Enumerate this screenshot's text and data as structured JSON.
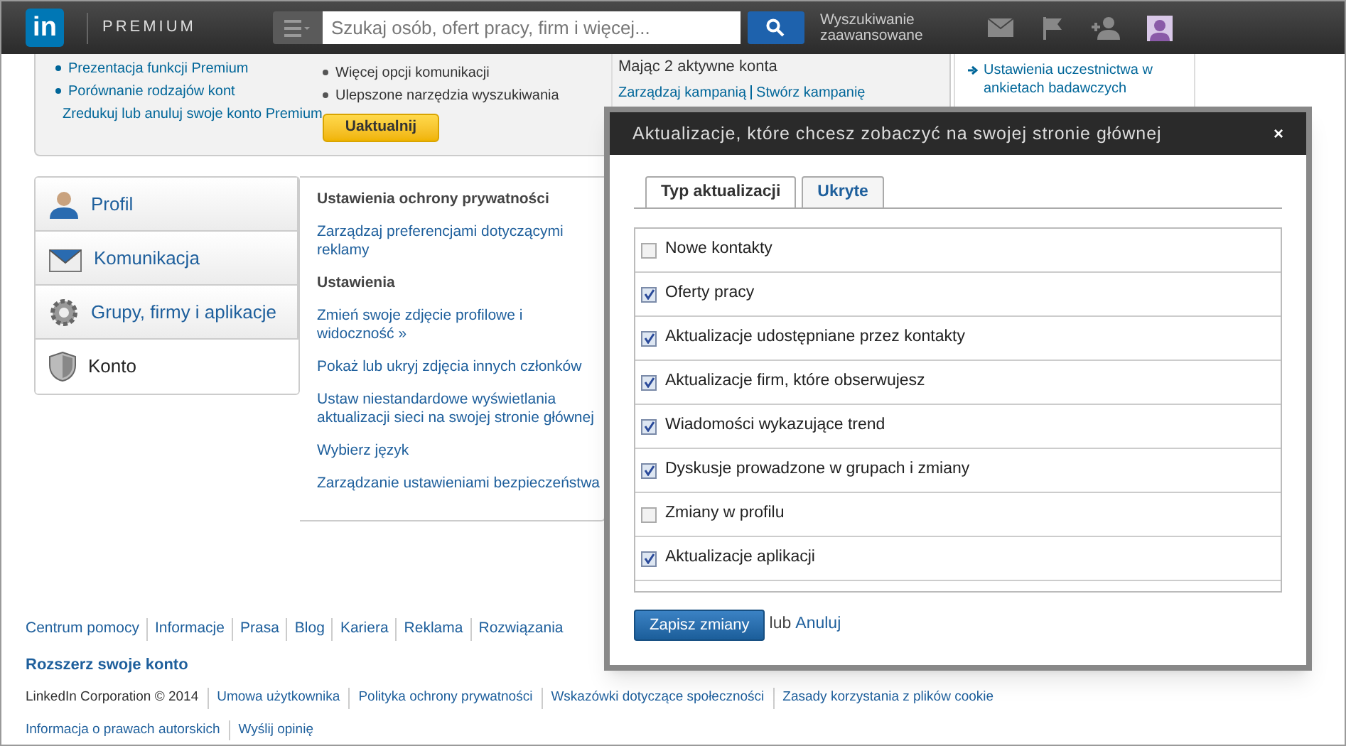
{
  "header": {
    "brand": "in",
    "premium": "PREMIUM",
    "search": {
      "placeholder": "Szukaj osób, ofert pracy, firm i więcej..."
    },
    "advanced": "Wyszukiwanie zaawansowane"
  },
  "premium_box": {
    "col1": [
      "Prezentacja funkcji Premium",
      "Porównanie rodzajów kont",
      "Zredukuj lub anuluj swoje konto Premium"
    ],
    "col2": [
      "Więcej opcji komunikacji",
      "Ulepszone narzędzia wyszukiwania"
    ],
    "upgrade": "Uaktualnij",
    "col3_heading": "Mając 2 aktywne konta",
    "col3_links": [
      "Zarządzaj kampanią",
      "Stwórz kampanię"
    ]
  },
  "side_box": {
    "link": "Ustawienia uczestnictwa w ankietach badawczych"
  },
  "sidebar": {
    "items": [
      {
        "label": "Profil",
        "kind": "profile",
        "selected": false
      },
      {
        "label": "Komunikacja",
        "kind": "mail",
        "selected": false
      },
      {
        "label": "Grupy, firmy i aplikacje",
        "kind": "gear",
        "selected": false
      },
      {
        "label": "Konto",
        "kind": "shield",
        "selected": true
      }
    ]
  },
  "settings": [
    {
      "kind": "heading",
      "text": "Ustawienia ochrony prywatności"
    },
    {
      "kind": "link",
      "text": "Zarządzaj preferencjami dotyczącymi reklamy"
    },
    {
      "kind": "heading",
      "text": "Ustawienia"
    },
    {
      "kind": "link",
      "text": "Zmień swoje zdjęcie profilowe i widoczność »"
    },
    {
      "kind": "link",
      "text": "Pokaż lub ukryj zdjęcia innych członków"
    },
    {
      "kind": "link",
      "text": "Ustaw niestandardowe wyświetlania aktualizacji sieci na swojej stronie głównej"
    },
    {
      "kind": "link",
      "text": "Wybierz język"
    },
    {
      "kind": "link",
      "text": "Zarządzanie ustawieniami bezpieczeństwa"
    }
  ],
  "footer": {
    "links": [
      "Centrum pomocy",
      "Informacje",
      "Prasa",
      "Blog",
      "Kariera",
      "Reklama",
      "Rozwiązania"
    ],
    "upgrade": "Rozszerz swoje konto",
    "copyright": "LinkedIn Corporation © 2014",
    "legal": [
      "Umowa użytkownika",
      "Polityka ochrony prywatności",
      "Wskazówki dotyczące społeczności",
      "Zasady korzystania z plików cookie",
      "Informacja o prawach autorskich",
      "Wyślij opinię"
    ]
  },
  "dialog": {
    "title": "Aktualizacje, które chcesz zobaczyć na swojej stronie głównej",
    "close": "×",
    "tabs": [
      {
        "label": "Typ aktualizacji",
        "selected": true
      },
      {
        "label": "Ukryte",
        "selected": false
      }
    ],
    "options": [
      {
        "label": "Nowe kontakty",
        "checked": false
      },
      {
        "label": "Oferty pracy",
        "checked": true
      },
      {
        "label": "Aktualizacje udostępniane przez kontakty",
        "checked": true
      },
      {
        "label": "Aktualizacje firm, które obserwujesz",
        "checked": true
      },
      {
        "label": "Wiadomości wykazujące trend",
        "checked": true
      },
      {
        "label": "Dyskusje prowadzone w grupach i zmiany",
        "checked": true
      },
      {
        "label": "Zmiany w profilu",
        "checked": false
      },
      {
        "label": "Aktualizacje aplikacji",
        "checked": true
      }
    ],
    "save": "Zapisz zmiany",
    "or": "lub",
    "cancel": "Anuluj"
  }
}
